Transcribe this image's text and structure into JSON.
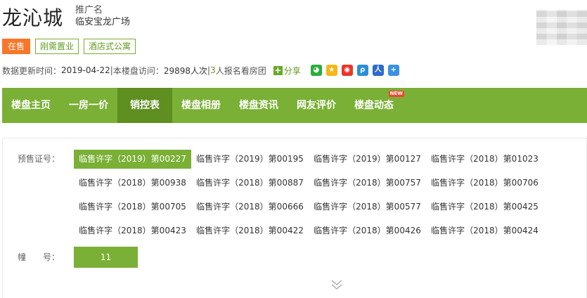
{
  "header": {
    "title": "龙沁城",
    "promo_label": "推广名",
    "promo_name": "临安宝龙广场"
  },
  "tags": [
    "在售",
    "刚需置业",
    "酒店式公寓"
  ],
  "info": {
    "update_label": "数据更新时间：",
    "update_date": "2019-04-22",
    "sep1": "|",
    "visits_label": "本楼盘访问：",
    "visits_count": "29898人次",
    "sep2": "|",
    "signup_count": "3",
    "signup_text": "人报名看房团",
    "share_label": "分享"
  },
  "social_icons": [
    "wechat-icon",
    "qzone-icon",
    "weibo-icon",
    "tencent-weibo-icon",
    "renren-icon",
    "more-share-icon"
  ],
  "nav": {
    "items": [
      "楼盘主页",
      "一房一价",
      "销控表",
      "楼盘相册",
      "楼盘资讯",
      "网友评价",
      "楼盘动态"
    ],
    "active": "销控表",
    "new_badge": "NEW"
  },
  "panel": {
    "permit_label": "预售证号：",
    "building_label": "幢　　号：",
    "permits": [
      "临售许字（2019）第00227",
      "临售许字（2019）第00195",
      "临售许字（2019）第00127",
      "临售许字（2018）第01023",
      "临售许字（2018）第00938",
      "临售许字（2018）第00887",
      "临售许字（2018）第00757",
      "临售许字（2018）第00706",
      "临售许字（2018）第00705",
      "临售许字（2018）第00666",
      "临售许字（2018）第00577",
      "临售许字（2018）第00425",
      "临售许字（2018）第00423",
      "临售许字（2018）第00422",
      "临售许字（2018）第00426",
      "临售许字（2018）第00424"
    ],
    "active_permit": "临售许字（2019）第00227",
    "building": "11"
  },
  "colors": {
    "accent": "#7ab035",
    "accent_dark": "#5f8f20",
    "sale": "#f7772a"
  }
}
